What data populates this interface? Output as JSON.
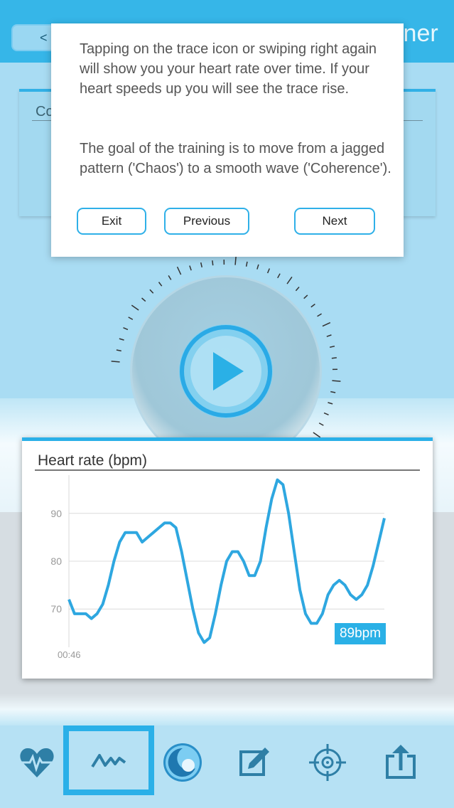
{
  "header": {
    "back_label": "<",
    "title_fragment": "iner"
  },
  "panel": {
    "label": "Co"
  },
  "dialog": {
    "paragraph1": "Tapping on the trace icon or swiping right again will show you your heart rate over time. If your heart speeds up you will see the trace rise.",
    "paragraph2": "The goal of the training is to move from a jagged pattern ('Chaos') to a smooth wave ('Coherence').",
    "buttons": {
      "exit": "Exit",
      "previous": "Previous",
      "next": "Next"
    }
  },
  "play_button": {
    "icon": "play-icon",
    "color": "#2ab0e6"
  },
  "heart_rate": {
    "title": "Heart rate (bpm)",
    "current": "89bpm"
  },
  "chart_data": {
    "type": "line",
    "title": "Heart rate (bpm)",
    "xlabel": "",
    "ylabel": "",
    "ylim": [
      62,
      98
    ],
    "yticks": [
      70,
      80,
      90
    ],
    "x_start_label": "00:46",
    "grid": true,
    "color": "#2ea7e0",
    "series": [
      {
        "values": [
          72,
          69,
          69,
          69,
          68,
          69,
          71,
          75,
          80,
          84,
          86,
          86,
          86,
          84,
          85,
          86,
          87,
          88,
          88,
          87,
          82,
          76,
          70,
          65,
          63,
          64,
          69,
          75,
          80,
          82,
          82,
          80,
          77,
          77,
          80,
          87,
          93,
          97,
          96,
          90,
          82,
          74,
          69,
          67,
          67,
          69,
          73,
          75,
          76,
          75,
          73,
          72,
          73,
          75,
          79,
          84,
          89
        ]
      }
    ]
  },
  "nav": [
    {
      "name": "heart-icon"
    },
    {
      "name": "trace-icon",
      "selected": true
    },
    {
      "name": "coherence-icon"
    },
    {
      "name": "edit-icon"
    },
    {
      "name": "target-icon"
    },
    {
      "name": "share-icon"
    }
  ]
}
